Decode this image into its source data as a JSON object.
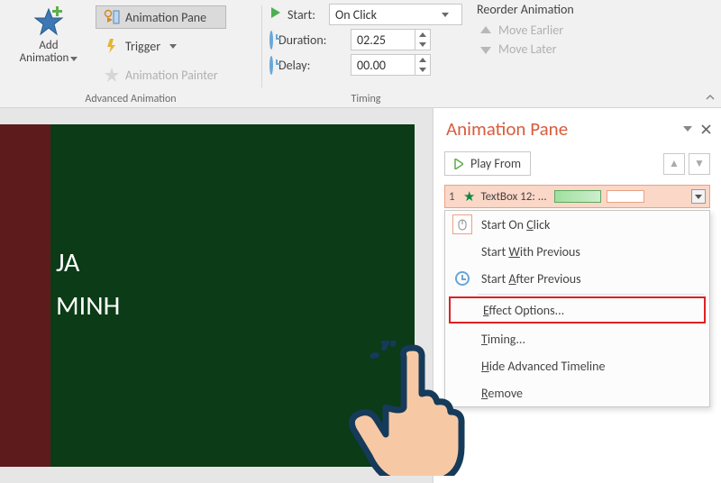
{
  "ribbon": {
    "add_animation": {
      "label_line1": "Add",
      "label_line2": "Animation"
    },
    "animation_pane": "Animation Pane",
    "trigger": "Trigger",
    "animation_painter": "Animation Painter",
    "group_advanced": "Advanced Animation",
    "start_label": "Start:",
    "start_value": "On Click",
    "duration_label": "Duration:",
    "duration_value": "02.25",
    "delay_label": "Delay:",
    "delay_value": "00.00",
    "group_timing": "Timing",
    "reorder_title": "Reorder Animation",
    "move_earlier": "Move Earlier",
    "move_later": "Move Later"
  },
  "slide": {
    "line1": "JA",
    "line2": "MINH"
  },
  "pane": {
    "title": "Animation Pane",
    "play_from": "Play From",
    "item": {
      "index": "1",
      "name": "TextBox 12: ..."
    },
    "ctx": {
      "start_on_click": "Start On Click",
      "start_with_previous": "Start With Previous",
      "start_after_previous": "Start After Previous",
      "effect_options": "Effect Options...",
      "timing": "Timing...",
      "hide_advanced": "Hide Advanced Timeline",
      "remove": "Remove"
    }
  }
}
